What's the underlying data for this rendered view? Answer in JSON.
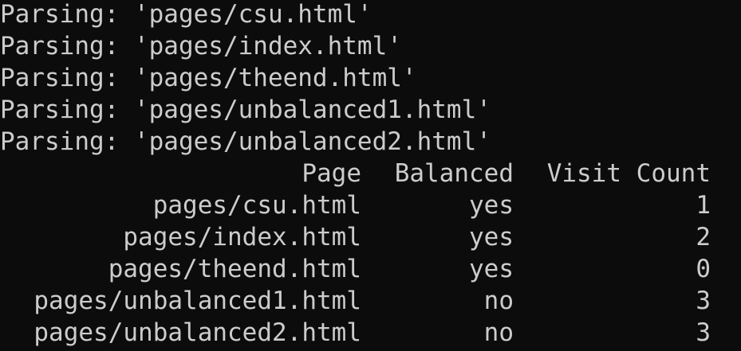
{
  "terminal": {
    "background": "#0c0c0c",
    "foreground": "#cccccc",
    "parse_lines": [
      "Parsing: 'pages/csu.html'",
      "Parsing: 'pages/index.html'",
      "Parsing: 'pages/theend.html'",
      "Parsing: 'pages/unbalanced1.html'",
      "Parsing: 'pages/unbalanced2.html'"
    ],
    "table": {
      "headers": [
        "Page",
        "Balanced",
        "Visit Count"
      ],
      "rows": [
        [
          "pages/csu.html",
          "yes",
          "1"
        ],
        [
          "pages/index.html",
          "yes",
          "2"
        ],
        [
          "pages/theend.html",
          "yes",
          "0"
        ],
        [
          "pages/unbalanced1.html",
          "no",
          "3"
        ],
        [
          "pages/unbalanced2.html",
          "no",
          "3"
        ]
      ]
    }
  }
}
